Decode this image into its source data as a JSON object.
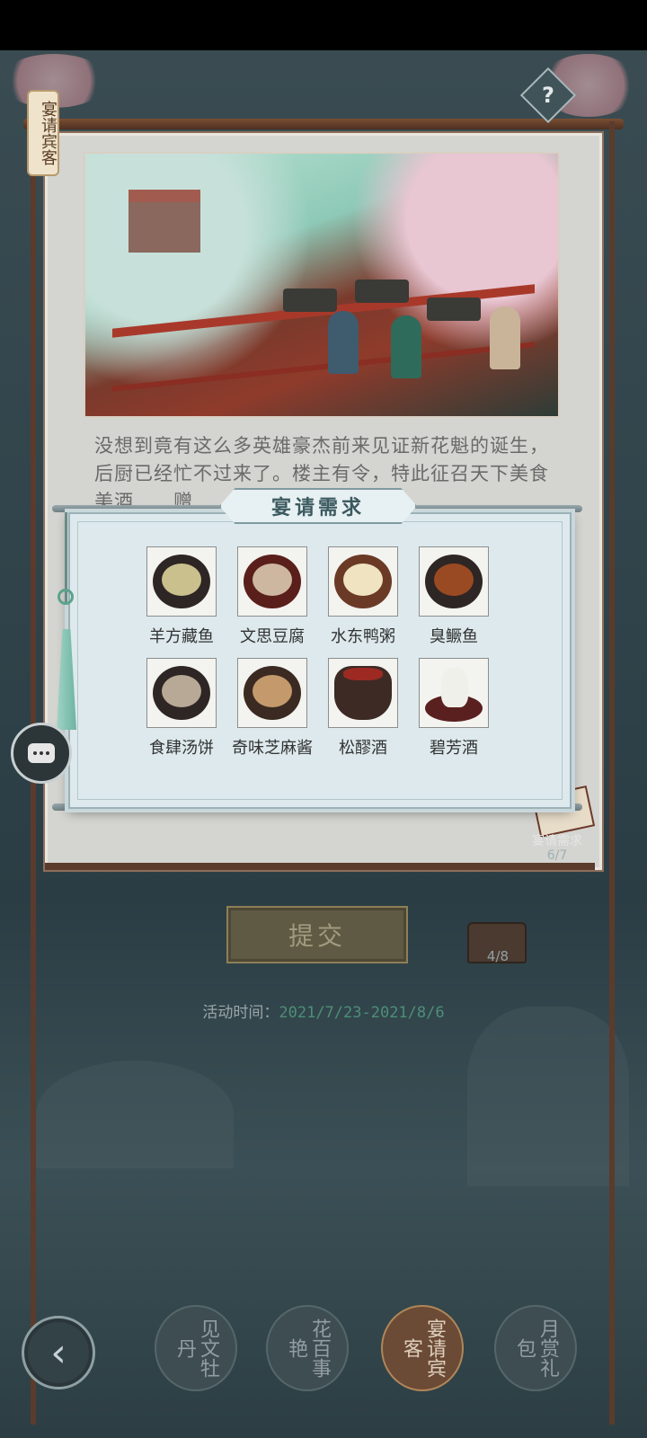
{
  "side_tab": {
    "label": "宴请宾客"
  },
  "help": {
    "label": "?"
  },
  "story": {
    "text": "没想到竟有这么多英雄豪杰前来见证新花魁的诞生，后厨已经忙不过来了。楼主有令，特此征召天下美食美酒……赠"
  },
  "modal": {
    "title": "宴请需求",
    "dishes": [
      {
        "name": "羊方藏鱼",
        "icon": "dish-fish-lamb-icon"
      },
      {
        "name": "文思豆腐",
        "icon": "dish-tofu-soup-icon"
      },
      {
        "name": "水东鸭粥",
        "icon": "dish-duck-porridge-icon"
      },
      {
        "name": "臭鳜鱼",
        "icon": "dish-mandarin-fish-icon"
      },
      {
        "name": "食肆汤饼",
        "icon": "dish-noodle-soup-icon"
      },
      {
        "name": "奇味芝麻酱",
        "icon": "dish-sesame-paste-icon"
      },
      {
        "name": "松醪酒",
        "icon": "wine-jar-icon"
      },
      {
        "name": "碧芳酒",
        "icon": "wine-bottle-icon"
      }
    ]
  },
  "demand_counter": {
    "label": "宴请需求",
    "count": "6/7"
  },
  "submit": {
    "label": "提交"
  },
  "chest": {
    "count": "4/8"
  },
  "activity": {
    "label": "活动时间：",
    "dates": "2021/7/23-2021/8/6"
  },
  "nav": {
    "back_icon": "back-arrow-icon",
    "tabs": [
      {
        "label": "见文牡丹",
        "active": false
      },
      {
        "label": "花百事艳",
        "active": false
      },
      {
        "label": "宴请宾客",
        "active": true
      },
      {
        "label": "月赏礼包",
        "active": false
      }
    ]
  },
  "colors": {
    "modal_bg": "#dde9ed",
    "accent_green": "#4d8f76",
    "frame_brown": "#5a3b2c"
  }
}
